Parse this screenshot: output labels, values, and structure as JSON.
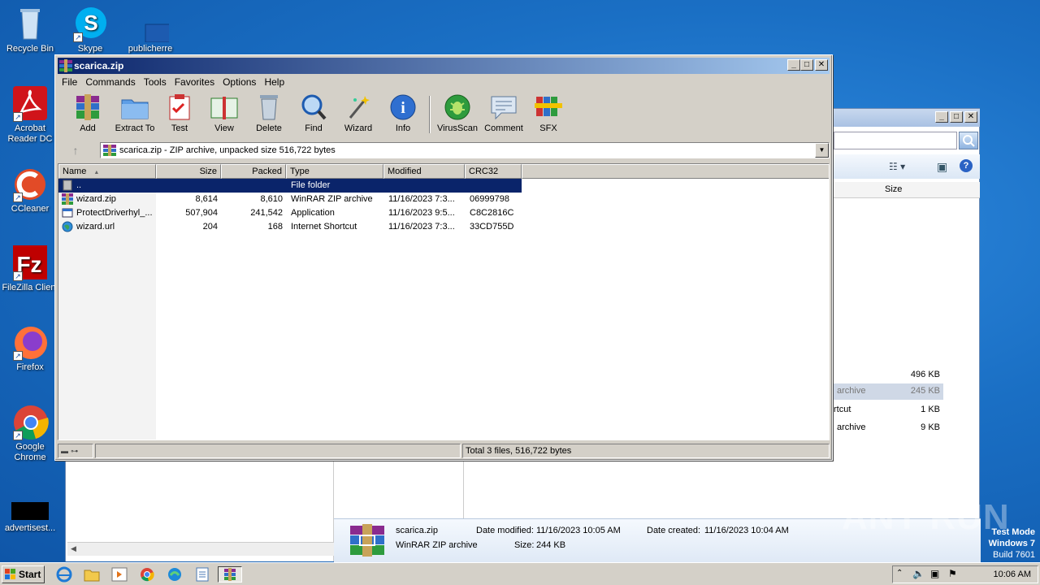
{
  "desktop": {
    "icons": [
      {
        "label": "Recycle Bin"
      },
      {
        "label": "Skype"
      },
      {
        "label": "publicherre"
      },
      {
        "label": "Acrobat Reader DC"
      },
      {
        "label": "CCleaner"
      },
      {
        "label": "FileZilla Client"
      },
      {
        "label": "Firefox"
      },
      {
        "label": "Google Chrome"
      },
      {
        "label": "advertisest..."
      }
    ]
  },
  "bg_explorer": {
    "col_size": "Size",
    "rows": [
      {
        "type": "",
        "size": "496 KB"
      },
      {
        "type": "archive",
        "size": "245 KB"
      },
      {
        "type": "rtcut",
        "size": "1 KB"
      },
      {
        "type": "archive",
        "size": "9 KB"
      }
    ],
    "details": {
      "name": "scarica.zip",
      "type": "WinRAR ZIP archive",
      "modified_label": "Date modified:",
      "modified": "11/16/2023 10:05 AM",
      "size_label": "Size:",
      "size": "244 KB",
      "created_label": "Date created:",
      "created": "11/16/2023 10:04 AM"
    }
  },
  "winrar": {
    "title": "scarica.zip",
    "menu": [
      "File",
      "Commands",
      "Tools",
      "Favorites",
      "Options",
      "Help"
    ],
    "toolbar": [
      "Add",
      "Extract To",
      "Test",
      "View",
      "Delete",
      "Find",
      "Wizard",
      "Info",
      "VirusScan",
      "Comment",
      "SFX"
    ],
    "path": "scarica.zip - ZIP archive, unpacked size 516,722 bytes",
    "columns": [
      "Name",
      "Size",
      "Packed",
      "Type",
      "Modified",
      "CRC32"
    ],
    "files": [
      {
        "name": "..",
        "size": "",
        "packed": "",
        "type": "File folder",
        "modified": "",
        "crc": ""
      },
      {
        "name": "wizard.zip",
        "size": "8,614",
        "packed": "8,610",
        "type": "WinRAR ZIP archive",
        "modified": "11/16/2023 7:3...",
        "crc": "06999798"
      },
      {
        "name": "ProtectDriverhyl_...",
        "size": "507,904",
        "packed": "241,542",
        "type": "Application",
        "modified": "11/16/2023 9:5...",
        "crc": "C8C2816C"
      },
      {
        "name": "wizard.url",
        "size": "204",
        "packed": "168",
        "type": "Internet Shortcut",
        "modified": "11/16/2023 7:3...",
        "crc": "33CD755D"
      }
    ],
    "status_total": "Total 3 files, 516,722 bytes"
  },
  "taskbar": {
    "start": "Start",
    "clock": "10:06 AM"
  },
  "watermark": {
    "line1": "Test Mode",
    "line2": "Windows 7",
    "line3": "Build 7601",
    "brand": "ANY RUN"
  }
}
